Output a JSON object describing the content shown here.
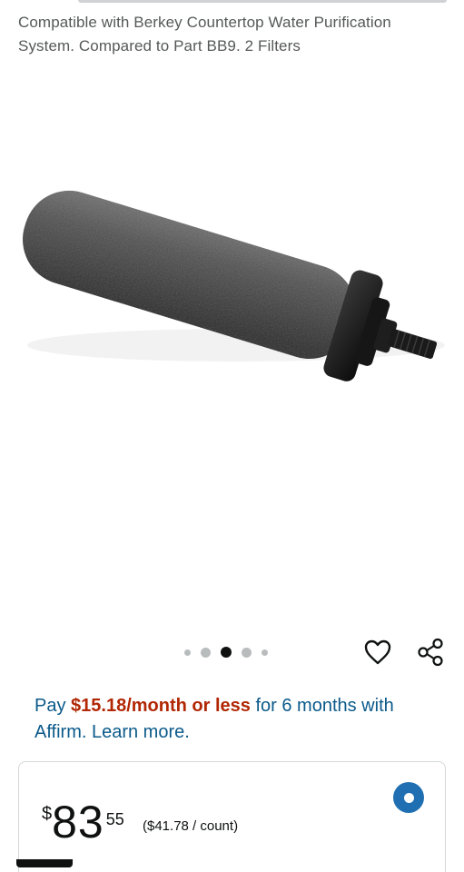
{
  "product": {
    "title": "Compatible with Berkey Countertop Water Purification System. Compared to Part BB9. 2 Filters"
  },
  "gallery": {
    "image_alt": "black filter cartridge",
    "total_images": 5,
    "active_index": 3
  },
  "icons": {
    "wishlist": "heart-icon",
    "share": "share-icon"
  },
  "affirm": {
    "prefix": "Pay ",
    "amount": "$15.18/month or less",
    "suffix": " for 6 months with Affirm. ",
    "link": "Learn more."
  },
  "price": {
    "currency": "$",
    "whole": "83",
    "fraction": "55",
    "per_unit": "($41.78 / count)"
  },
  "colors": {
    "link_blue": "#0b5a8a",
    "price_red": "#b12704",
    "radio_blue": "#1f6fb2"
  }
}
